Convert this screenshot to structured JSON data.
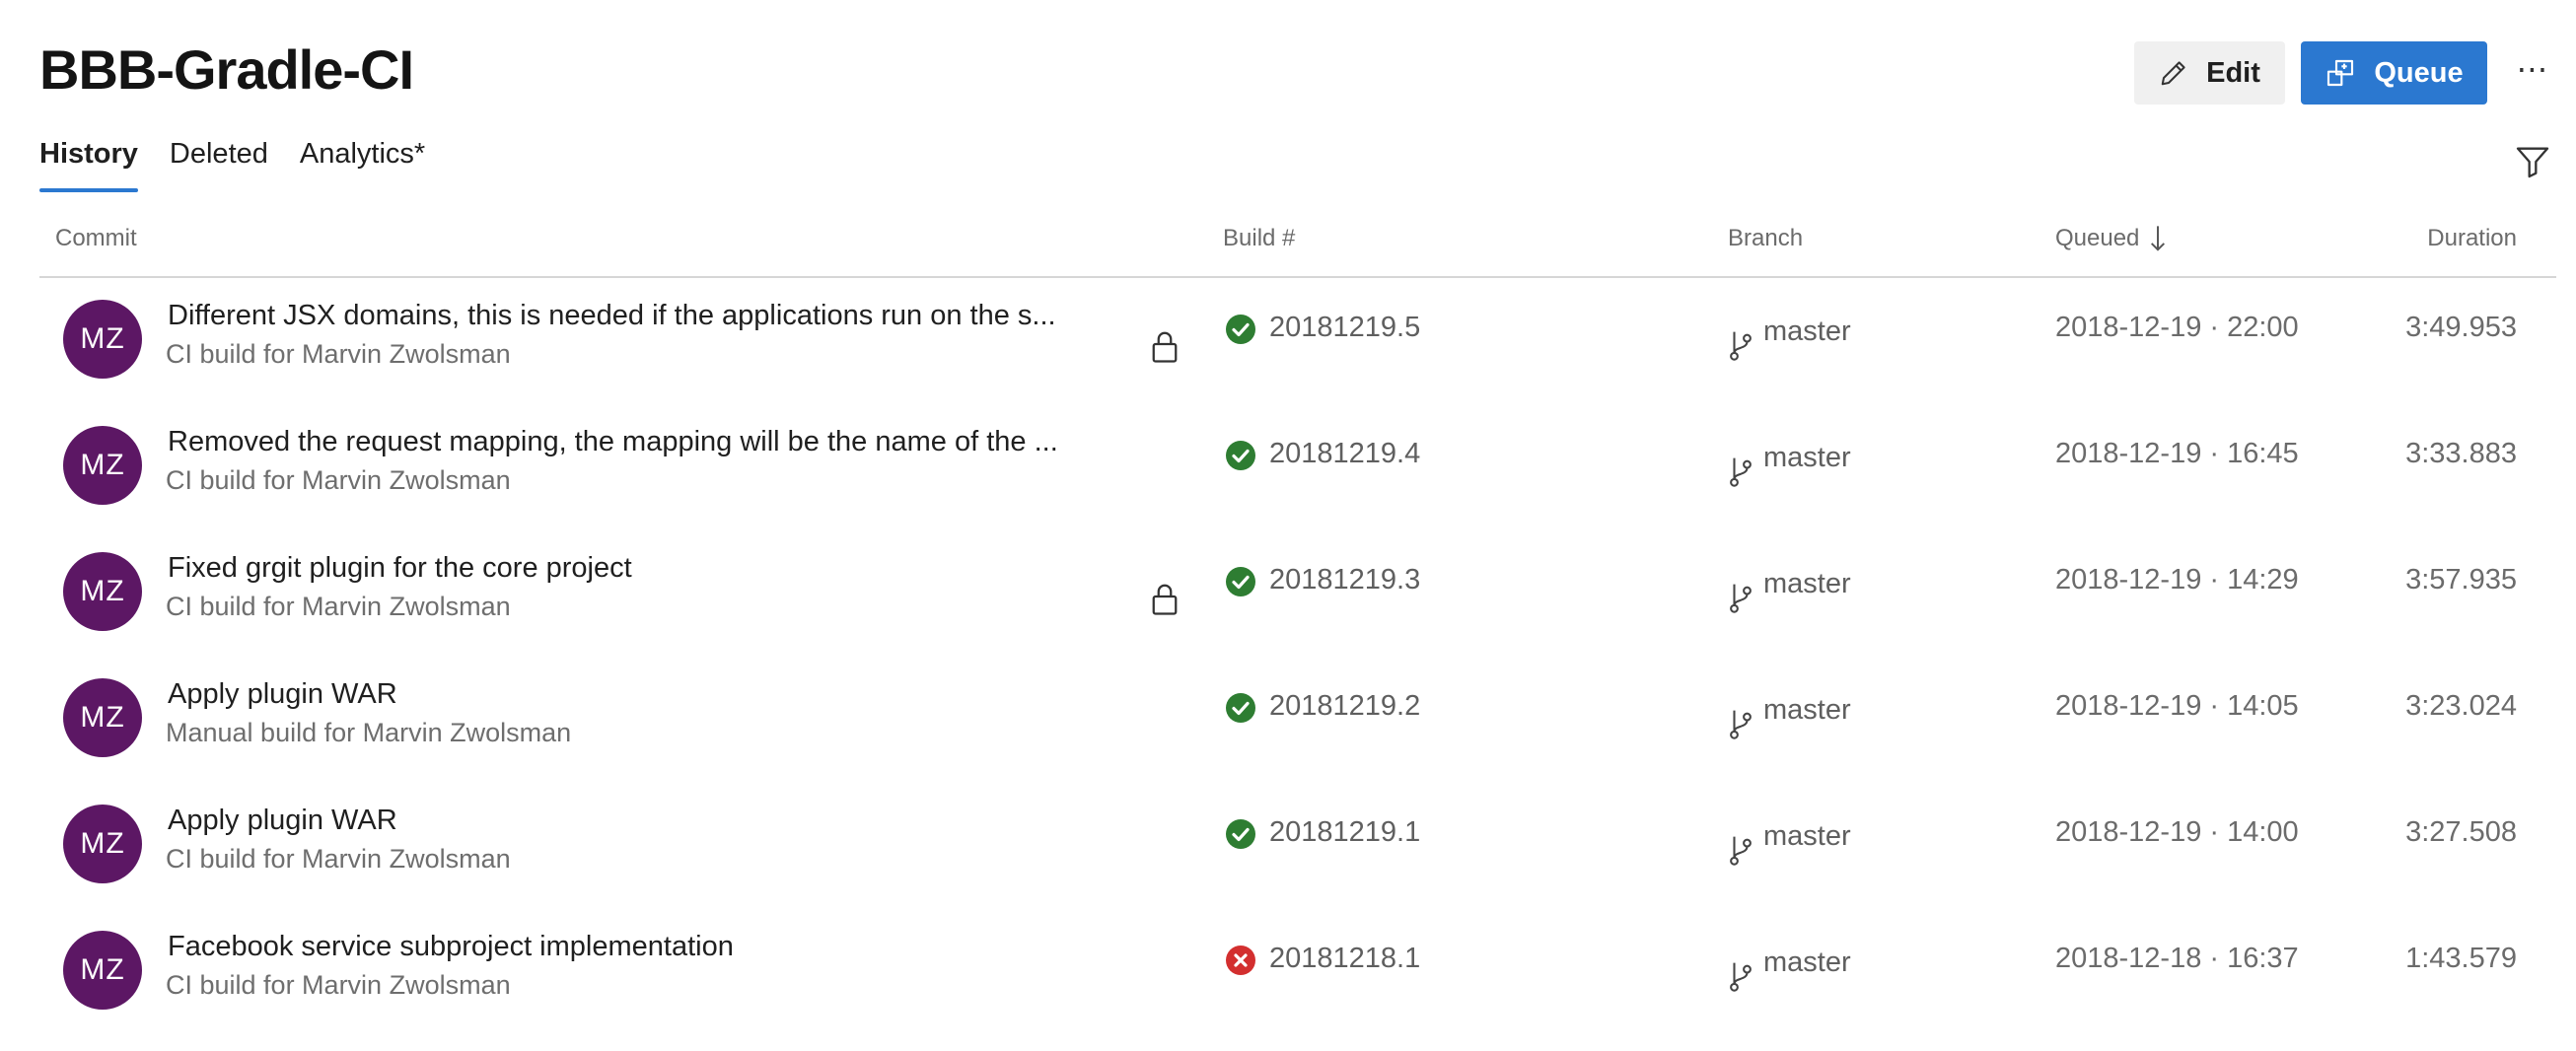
{
  "page": {
    "title": "BBB-Gradle-CI"
  },
  "toolbar": {
    "edit_label": "Edit",
    "queue_label": "Queue",
    "more_label": "⋯",
    "accent_color": "#2b78d0"
  },
  "tabs": [
    {
      "label": "History",
      "active": true
    },
    {
      "label": "Deleted",
      "active": false
    },
    {
      "label": "Analytics*",
      "active": false
    }
  ],
  "table": {
    "columns": {
      "commit": "Commit",
      "build": "Build #",
      "branch": "Branch",
      "queued": "Queued",
      "duration": "Duration"
    },
    "sort": {
      "column": "queued",
      "direction": "descending"
    },
    "rows": [
      {
        "avatar": "MZ",
        "title": "Different JSX domains, this is needed if the applications run on the s...",
        "subtitle": "CI build for Marvin Zwolsman",
        "locked": true,
        "status": "succeeded",
        "build": "20181219.5",
        "branch": "master",
        "queued": "2018-12-19 · 22:00",
        "duration": "3:49.953"
      },
      {
        "avatar": "MZ",
        "title": "Removed the request mapping, the mapping will be the name of the ...",
        "subtitle": "CI build for Marvin Zwolsman",
        "locked": false,
        "status": "succeeded",
        "build": "20181219.4",
        "branch": "master",
        "queued": "2018-12-19 · 16:45",
        "duration": "3:33.883"
      },
      {
        "avatar": "MZ",
        "title": "Fixed grgit plugin for the core project",
        "subtitle": "CI build for Marvin Zwolsman",
        "locked": true,
        "status": "succeeded",
        "build": "20181219.3",
        "branch": "master",
        "queued": "2018-12-19 · 14:29",
        "duration": "3:57.935"
      },
      {
        "avatar": "MZ",
        "title": "Apply plugin WAR",
        "subtitle": "Manual build for Marvin Zwolsman",
        "locked": false,
        "status": "succeeded",
        "build": "20181219.2",
        "branch": "master",
        "queued": "2018-12-19 · 14:05",
        "duration": "3:23.024"
      },
      {
        "avatar": "MZ",
        "title": "Apply plugin WAR",
        "subtitle": "CI build for Marvin Zwolsman",
        "locked": false,
        "status": "succeeded",
        "build": "20181219.1",
        "branch": "master",
        "queued": "2018-12-19 · 14:00",
        "duration": "3:27.508"
      },
      {
        "avatar": "MZ",
        "title": "Facebook service subproject implementation",
        "subtitle": "CI build for Marvin Zwolsman",
        "locked": false,
        "status": "failed",
        "build": "20181218.1",
        "branch": "master",
        "queued": "2018-12-18 · 16:37",
        "duration": "1:43.579"
      }
    ]
  },
  "colors": {
    "avatar": "#5c1764",
    "success": "#2e7d32",
    "failure": "#d32f2f"
  }
}
